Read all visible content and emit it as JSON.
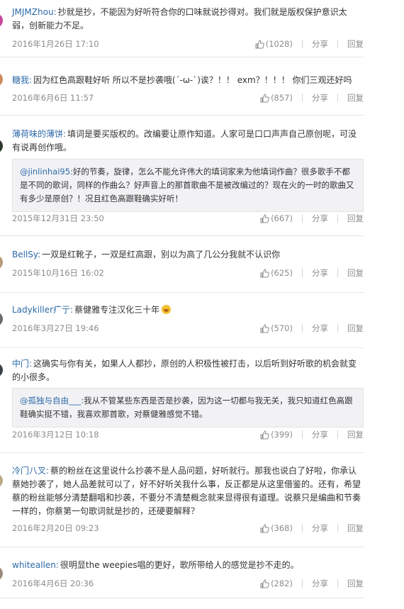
{
  "comments": [
    {
      "user": "JMJMZhou:",
      "text": "抄就是抄，不能因为好听符合你的口味就说抄得对。我们就是版权保护意识太弱，创新能力不足。",
      "date": "2016年1月26日 17:10",
      "likes": "(1028)",
      "share": "分享",
      "reply": "回复",
      "avatar_color": "#c8459a"
    },
    {
      "user": "糖我:",
      "text": "因为红色高跟鞋好听 所以不是抄袭哦(´-ω-`)诶？！！ exm？！！！ 你们三观还好吗",
      "date": "2016年6月6日 11:57",
      "likes": "(857)",
      "share": "分享",
      "reply": "回复",
      "avatar_color": "#d08a5c"
    },
    {
      "user": "薄荷味的薄饼:",
      "text": "填词是要买版权的。改编要让原作知道。人家可是口口声声自己原创呢，可没有说再创作哦。",
      "quote_user": "@jinlinhai95:",
      "quote_text": "好的节奏，旋律，怎么不能允许伟大的填词家来为他填词作曲？很多歌手不都是不同的歌词，同样的作曲么？好声音上的那首歌曲不是被改编过的？现在火的一时的歌曲又有多少是原创？！况且红色高跟鞋确实好听！",
      "date": "2015年12月31日 23:50",
      "likes": "(667)",
      "share": "分享",
      "reply": "回复",
      "avatar_color": "#2a3a2a"
    },
    {
      "user": "BellSy:",
      "text": "一双是红靴子，一双是红高跟，别以为高了几公分我就不认识你",
      "date": "2015年10月16日 16:02",
      "likes": "(625)",
      "share": "分享",
      "reply": "回复",
      "avatar_color": "#b89878"
    },
    {
      "user": "Ladykiller疒亍:",
      "text": "蔡健雅专注汉化三十年",
      "date": "2016年3月27日 19:46",
      "likes": "(570)",
      "share": "分享",
      "reply": "回复",
      "avatar_color": "#6a6a6a",
      "emoji": "laughing-tears-emoji"
    },
    {
      "user": "中门:",
      "text": "这确实与你有关，如果人人都抄，原创的人积极性被打击，以后听到好听歌的机会就变的小很多。",
      "quote_user": "@孤独与自由___:",
      "quote_text": "我从不管某些东西是否是抄袭，因为这一切都与我无关，我只知道红色高跟鞋确实挺不错，我喜欢那首歌，对蔡健雅感觉不错。",
      "date": "2016年3月12日 10:18",
      "likes": "(399)",
      "share": "分享",
      "reply": "回复",
      "avatar_color": "#3a4048"
    },
    {
      "user": "冷门八叉:",
      "text": "蔡的粉丝在这里说什么抄袭不是人品问题，好听就行。那我也说白了好啦，你承认蔡她抄袭了，她人品差就可以了，好不好听关我什么事，反正都是从这里借鉴的。还有，希望蔡的粉丝能够分清楚翻唱和抄袭，不要分不清楚概念就来显得很有道理。说蔡只是编曲和节奏一样的，你蔡第一句歌词就是抄的，还硬要解释？",
      "date": "2016年2月20日 09:23",
      "likes": "(368)",
      "share": "分享",
      "reply": "回复",
      "avatar_color": "#b8aa88"
    },
    {
      "user": "whiteallen:",
      "text": "很明显the weepies唱的更好，歌所带给人的感觉是抄不走的。",
      "date": "2016年4月6日 20:36",
      "likes": "(282)",
      "share": "分享",
      "reply": "回复",
      "avatar_color": "#9a8a7a"
    }
  ]
}
